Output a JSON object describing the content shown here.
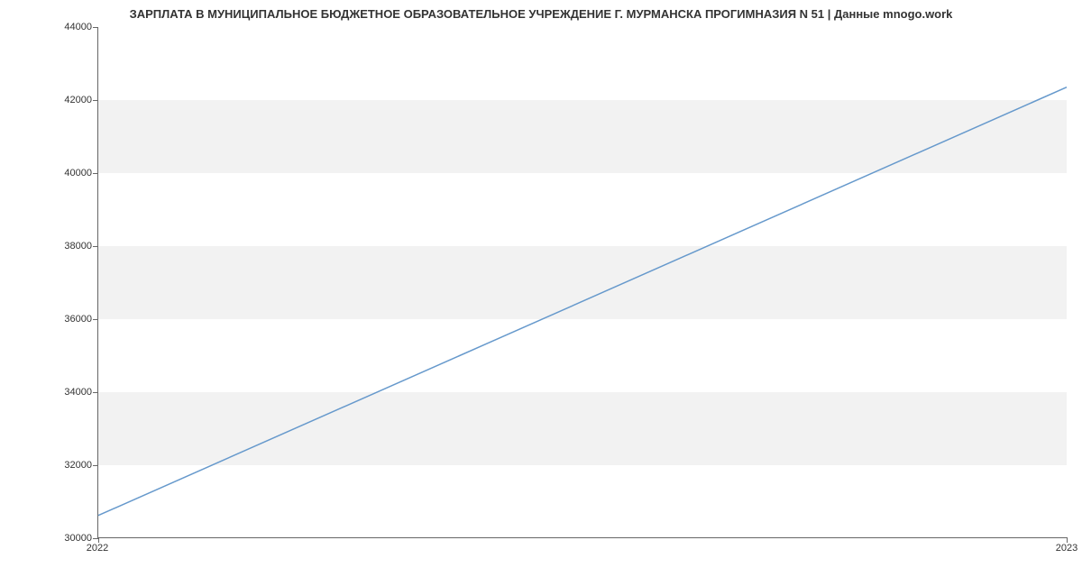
{
  "chart_data": {
    "type": "line",
    "title": "ЗАРПЛАТА В МУНИЦИПАЛЬНОЕ БЮДЖЕТНОЕ ОБРАЗОВАТЕЛЬНОЕ УЧРЕЖДЕНИЕ Г. МУРМАНСКА ПРОГИМНАЗИЯ N 51 | Данные mnogo.work",
    "xlabel": "",
    "ylabel": "",
    "x": [
      "2022",
      "2023"
    ],
    "values": [
      30600,
      42350
    ],
    "ylim": [
      30000,
      44000
    ],
    "y_ticks": [
      30000,
      32000,
      34000,
      36000,
      38000,
      40000,
      42000,
      44000
    ],
    "x_ticks": [
      "2022",
      "2023"
    ],
    "line_color": "#6699cc",
    "grid": true
  }
}
